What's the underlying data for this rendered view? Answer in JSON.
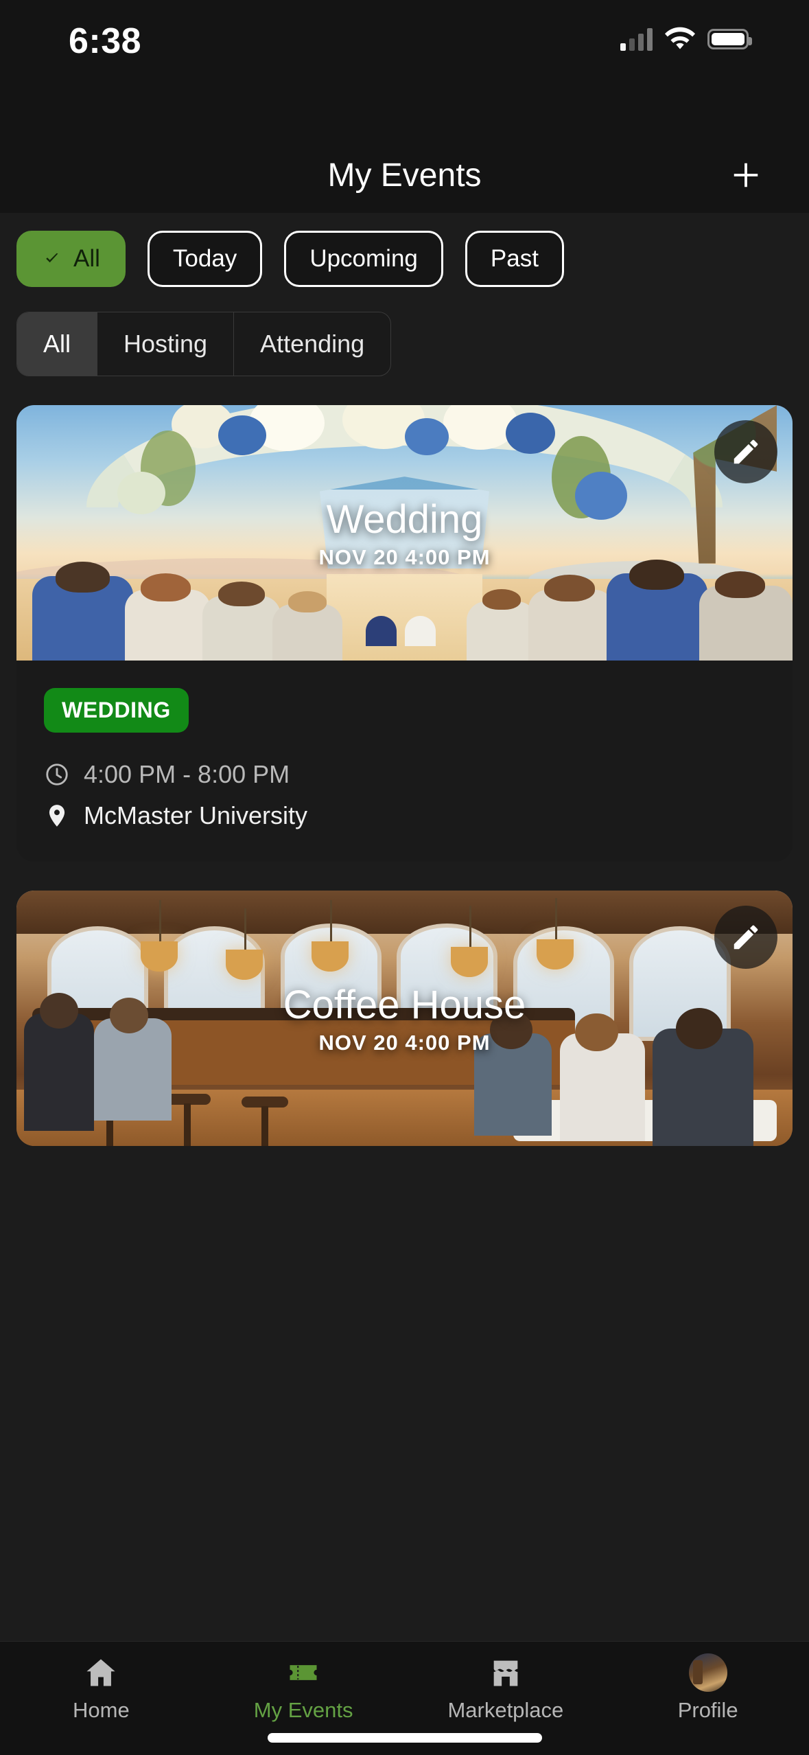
{
  "status_bar": {
    "time": "6:38",
    "cellular_icon": "cellular-signal-icon",
    "wifi_icon": "wifi-icon",
    "battery_icon": "battery-icon"
  },
  "header": {
    "title": "My Events",
    "add_label": "+",
    "add_icon": "plus-icon"
  },
  "filters": {
    "chips": [
      {
        "label": "All",
        "selected": true,
        "icon": "check-icon"
      },
      {
        "label": "Today",
        "selected": false
      },
      {
        "label": "Upcoming",
        "selected": false
      },
      {
        "label": "Past",
        "selected": false
      }
    ]
  },
  "segments": {
    "items": [
      {
        "label": "All",
        "selected": true
      },
      {
        "label": "Hosting",
        "selected": false
      },
      {
        "label": "Attending",
        "selected": false
      }
    ]
  },
  "events": [
    {
      "title": "Wedding",
      "overlay_when": "NOV 20 4:00 PM",
      "category": "WEDDING",
      "time_range": "4:00 PM  -  8:00 PM",
      "location": "McMaster University",
      "edit_icon": "pencil-icon",
      "clock_icon": "clock-icon",
      "pin_icon": "location-pin-icon",
      "image_alt": "beach-wedding-ceremony"
    },
    {
      "title": "Coffee House",
      "overlay_when": "NOV 20 4:00 PM",
      "edit_icon": "pencil-icon",
      "image_alt": "coffee-house-interior"
    }
  ],
  "tabbar": {
    "items": [
      {
        "label": "Home",
        "icon": "home-icon",
        "active": false
      },
      {
        "label": "My Events",
        "icon": "ticket-icon",
        "active": true
      },
      {
        "label": "Marketplace",
        "icon": "storefront-icon",
        "active": false
      },
      {
        "label": "Profile",
        "icon": "avatar-icon",
        "active": false
      }
    ]
  },
  "colors": {
    "accent_green": "#5b9534",
    "badge_green": "#128a17",
    "tab_active_green": "#64a244",
    "background": "#1c1c1c",
    "card_background": "#1a1a1a"
  }
}
